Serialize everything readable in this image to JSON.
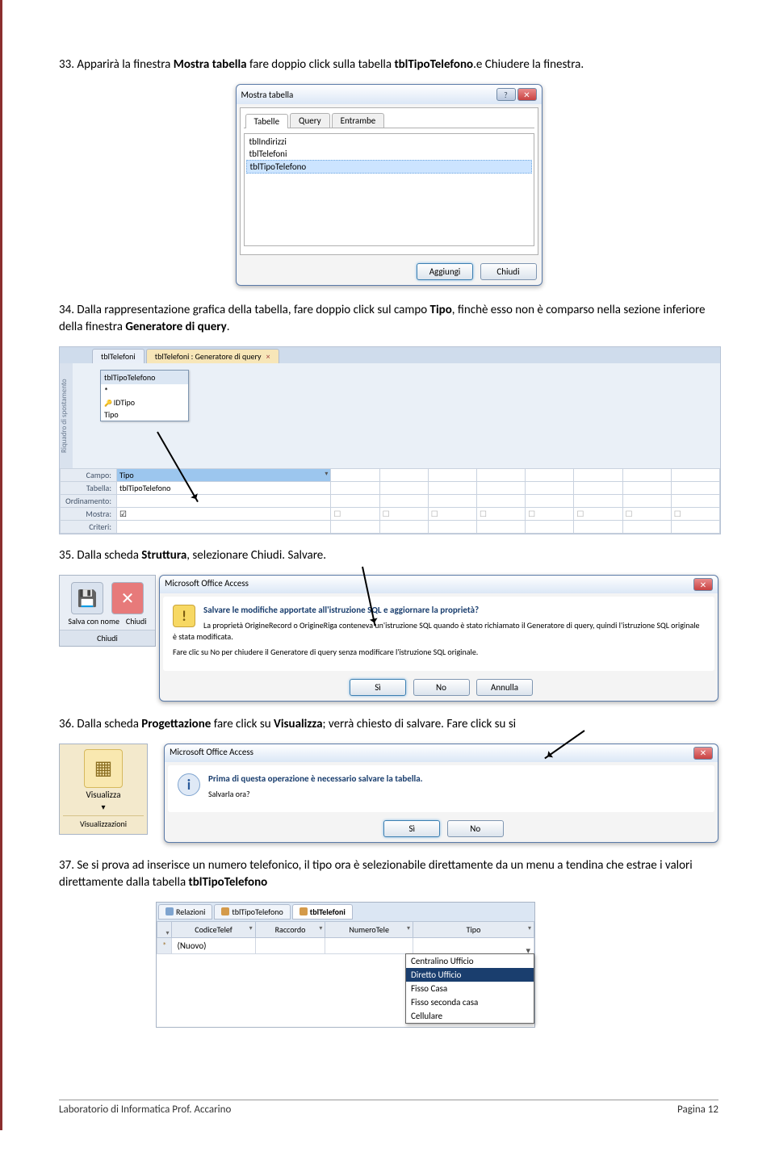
{
  "steps": {
    "s33": {
      "num": "33.",
      "t1": "Apparirà la finestra ",
      "b1": "Mostra tabella",
      "t2": " fare doppio click sulla tabella ",
      "b2": "tblTipoTelefono",
      "t3": ".e Chiudere la finestra."
    },
    "s34": {
      "num": "34.",
      "t1": "Dalla rappresentazione grafica della tabella, fare doppio click sul campo ",
      "b1": "Tipo",
      "t2": ", finchè esso non è comparso nella sezione inferiore della finestra ",
      "b2": "Generatore di query",
      "t3": "."
    },
    "s35": {
      "num": "35.",
      "t1": "Dalla scheda ",
      "b1": "Struttura",
      "t2": ", selezionare Chiudi. Salvare."
    },
    "s36": {
      "num": "36.",
      "t1": "Dalla scheda ",
      "b1": "Progettazione",
      "t2": " fare click su ",
      "b2": "Visualizza",
      "t3": "; verrà chiesto di salvare. Fare click su si"
    },
    "s37": {
      "num": "37.",
      "t1": "Se si prova ad inserisce un numero telefonico, il tipo ora è selezionabile direttamente da un menu a tendina che estrae i valori direttamente dalla tabella ",
      "b1": "tblTipoTelefono"
    }
  },
  "dlg1": {
    "title": "Mostra tabella",
    "tabs": [
      "Tabelle",
      "Query",
      "Entrambe"
    ],
    "items": [
      "tblIndirizzi",
      "tblTelefoni",
      "tblTipoTelefono"
    ],
    "btnAdd": "Aggiungi",
    "btnClose": "Chiudi",
    "help": "?",
    "x": "✕"
  },
  "qd": {
    "tab1": "tblTelefoni",
    "tab2": "tblTelefoni : Generatore di query",
    "sidebar": "Riquadro di spostamento",
    "tbox": {
      "hdr": "tblTipoTelefono",
      "star": "*",
      "f1": "IDTipo",
      "f2": "Tipo"
    },
    "grid": {
      "campo": "Campo:",
      "tabella": "Tabella:",
      "ordinamento": "Ordinamento:",
      "mostra": "Mostra:",
      "criteri": "Criteri:",
      "val_campo": "Tipo",
      "val_tabella": "tblTipoTelefono"
    }
  },
  "tbar1": {
    "icon1": "💾",
    "icon2": "✕",
    "lbl1": "Salva con nome",
    "lbl2": "Chiudi",
    "ftr": "Chiudi"
  },
  "msg1": {
    "title": "Microsoft Office Access",
    "hdr": "Salvare le modifiche apportate all'istruzione SQL e aggiornare la proprietà?",
    "line1": "La proprietà OrigineRecord o OrigineRiga conteneva un'istruzione SQL quando è stato richiamato il Generatore di query, quindi l'istruzione SQL originale è stata modificata.",
    "line2": "Fare clic su No per chiudere il Generatore di query senza modificare l'istruzione SQL originale.",
    "btnYes": "Sì",
    "btnNo": "No",
    "btnCancel": "Annulla",
    "x": "✕"
  },
  "tbar2": {
    "icon": "▦",
    "lbl": "Visualizza",
    "arrow": "▾",
    "ftr": "Visualizzazioni"
  },
  "msg2": {
    "title": "Microsoft Office Access",
    "hdr": "Prima di questa operazione è necessario salvare la tabella.",
    "line1": "Salvarla ora?",
    "btnYes": "Sì",
    "btnNo": "No",
    "x": "✕"
  },
  "ds": {
    "tabs": [
      "Relazioni",
      "tblTipoTelefono",
      "tblTelefoni"
    ],
    "cols": [
      "CodiceTelef",
      "Raccordo",
      "NumeroTele",
      "Tipo"
    ],
    "newrow": "(Nuovo)",
    "star": "*",
    "options": [
      "Centralino Ufficio",
      "Diretto Ufficio",
      "Fisso Casa",
      "Fisso seconda casa",
      "Cellulare"
    ]
  },
  "footer": {
    "left": "Laboratorio di Informatica Prof. Accarino",
    "right": "Pagina 12"
  }
}
